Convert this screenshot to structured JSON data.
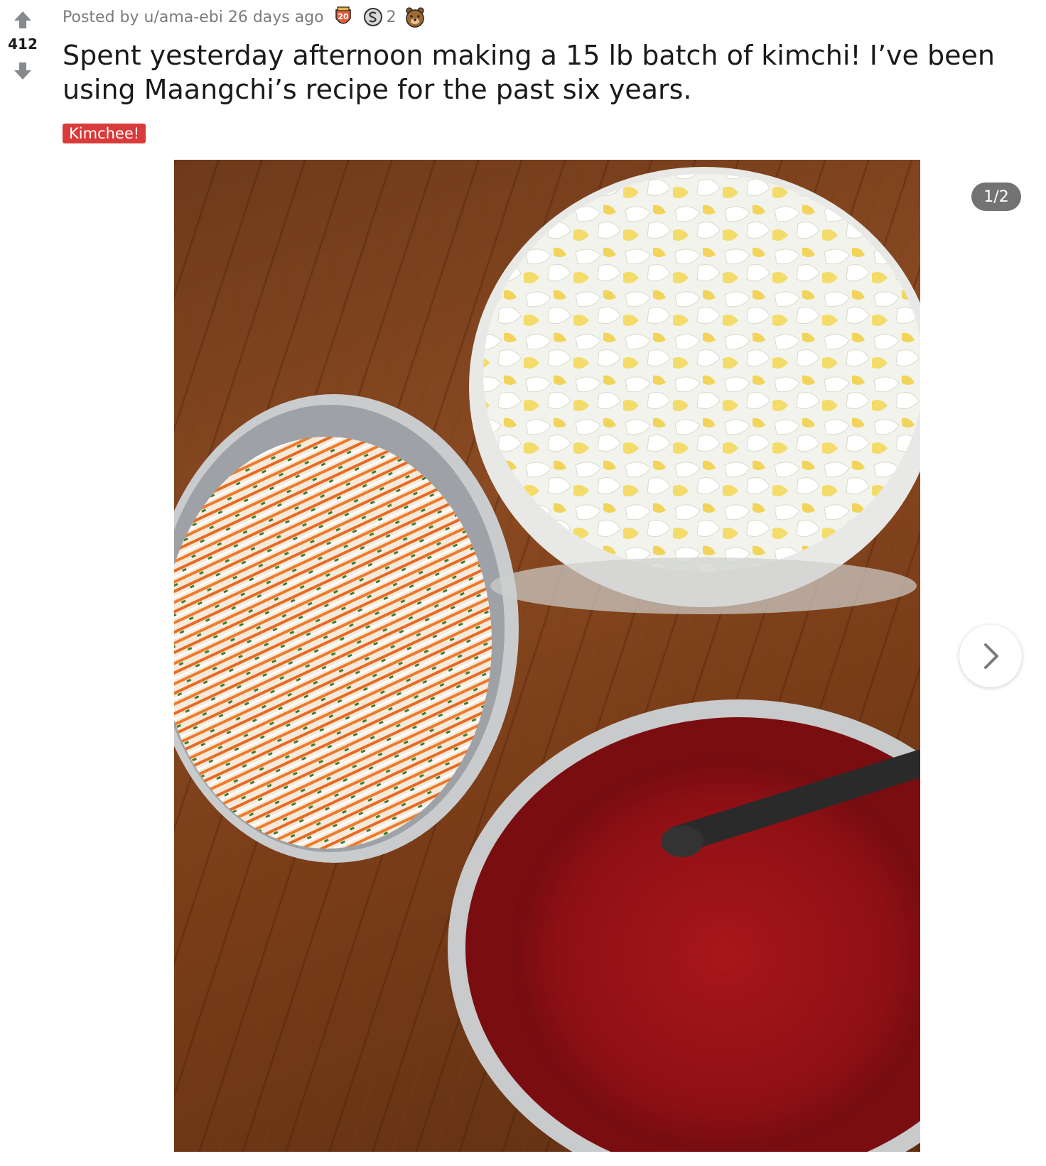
{
  "post": {
    "score": "412",
    "posted_prefix": "Posted by",
    "author": "u/ama-ebi",
    "age": "26 days ago",
    "awards": [
      {
        "icon": "twenty-award-icon",
        "label": "20"
      },
      {
        "icon": "silver-s-award-icon",
        "count": "2"
      },
      {
        "icon": "bear-award-icon"
      }
    ],
    "title": "Spent yesterday afternoon making a 15 lb batch of kimchi! I’ve been using Maangchi’s recipe for the past six years.",
    "flair": "Kimchee!"
  },
  "gallery": {
    "counter": "1/2",
    "next_icon": "chevron-right-icon"
  },
  "colors": {
    "flair_bg": "#d93a3a",
    "vote_arrow": "#878a8c",
    "meta_text": "#7c7c7c",
    "title_text": "#1a1a1b"
  }
}
